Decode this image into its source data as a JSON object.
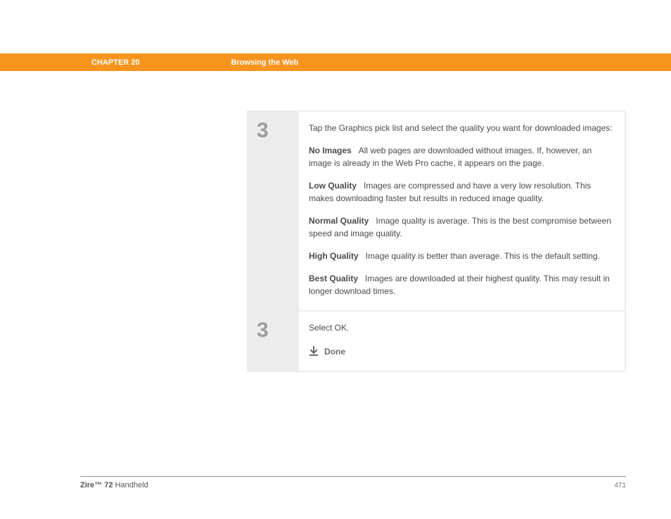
{
  "header": {
    "chapter": "CHAPTER 20",
    "section": "Browsing the Web"
  },
  "steps": [
    {
      "number": "3",
      "intro": "Tap the Graphics pick list and select the quality you want for downloaded images:",
      "options": [
        {
          "name": "No Images",
          "desc": "All web pages are downloaded without images. If, however, an image is already in the Web Pro cache, it appears on the page."
        },
        {
          "name": "Low Quality",
          "desc": "Images are compressed and have a very low resolution. This makes downloading faster but results in reduced image quality."
        },
        {
          "name": "Normal Quality",
          "desc": "Image quality is average. This is the best compromise between speed and image quality."
        },
        {
          "name": "High Quality",
          "desc": "Image quality is better than average. This is the default setting."
        },
        {
          "name": "Best Quality",
          "desc": "Images are downloaded at their highest quality. This may result in longer download times."
        }
      ]
    },
    {
      "number": "3",
      "text": "Select OK.",
      "done": "Done"
    }
  ],
  "footer": {
    "brand": "Zire",
    "tm": "™",
    "model": "72",
    "product": "Handheld",
    "page": "471"
  }
}
